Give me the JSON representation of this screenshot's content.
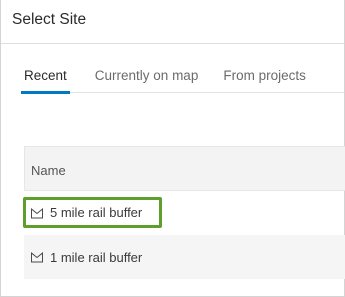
{
  "header": {
    "title": "Select Site"
  },
  "tabs": [
    {
      "label": "Recent"
    },
    {
      "label": "Currently on map"
    },
    {
      "label": "From projects"
    }
  ],
  "table": {
    "column_header": "Name",
    "rows": [
      {
        "name": "5 mile rail buffer",
        "icon": "polygon-icon"
      },
      {
        "name": "1 mile rail buffer",
        "icon": "polygon-icon"
      }
    ]
  },
  "colors": {
    "tab_active_underline": "#007ac2",
    "selection_highlight": "#5e9e2b"
  }
}
